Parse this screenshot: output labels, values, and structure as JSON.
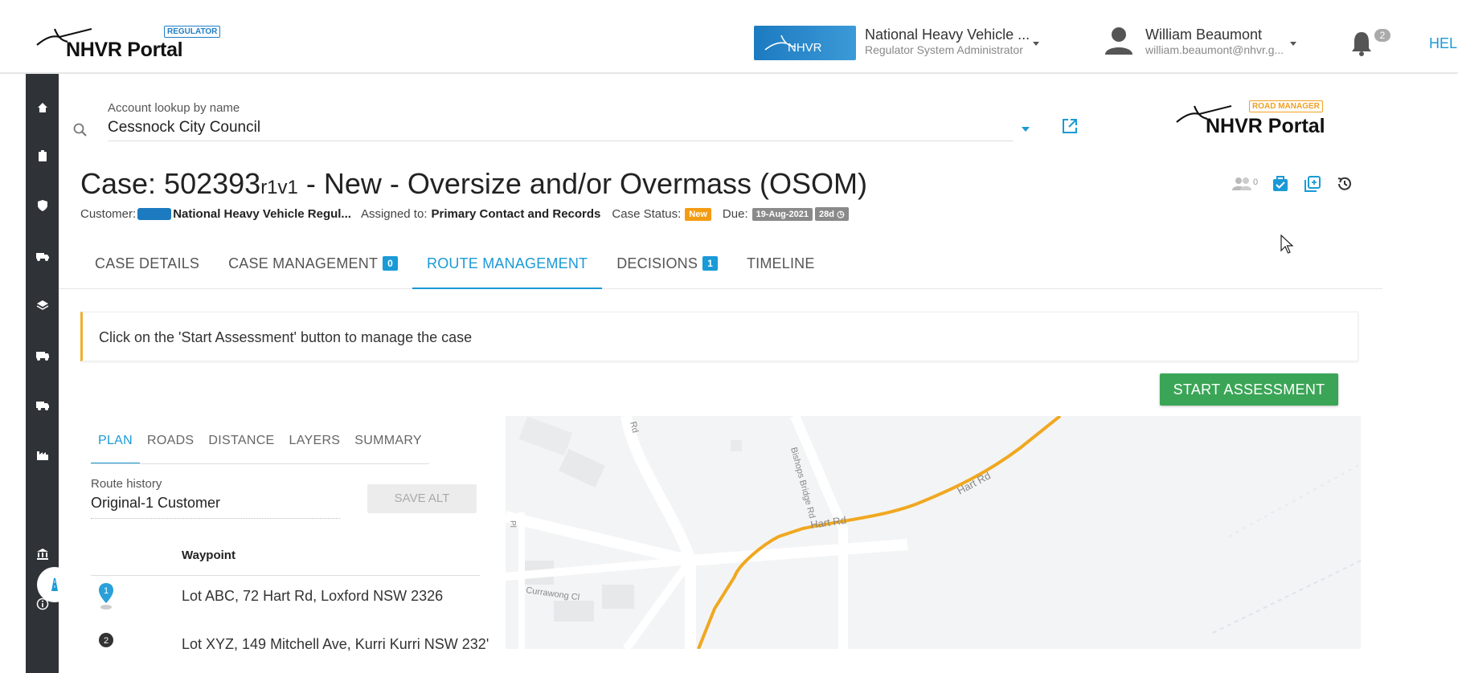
{
  "header": {
    "logo_text": "NHVR Portal",
    "logo_badge": "REGULATOR",
    "org_logo_text": "NHVR",
    "org_name": "National Heavy Vehicle ...",
    "org_role": "Regulator System Administrator",
    "user_name": "William Beaumont",
    "user_email": "william.beaumont@nhvr.g...",
    "notification_count": "2",
    "help_label": "HEL"
  },
  "account_lookup": {
    "label": "Account lookup by name",
    "value": "Cessnock City Council"
  },
  "road_manager_logo": {
    "text": "NHVR Portal",
    "badge": "ROAD MANAGER"
  },
  "case": {
    "title_prefix": "Case: 502393",
    "revision": "r1v1",
    "title_suffix": " - New - Oversize and/or Overmass (OSOM)",
    "customer_label": "Customer:",
    "customer_name": "National Heavy Vehicle Regul...",
    "assigned_label": "Assigned to:",
    "assigned_value": "Primary Contact and Records",
    "status_label": "Case Status:",
    "status_value": "New",
    "due_label": "Due:",
    "due_date": "19-Aug-2021",
    "due_days": "28d",
    "watchers_count": "0"
  },
  "tabs": [
    {
      "label": "CASE DETAILS",
      "count": ""
    },
    {
      "label": "CASE MANAGEMENT",
      "count": "0"
    },
    {
      "label": "ROUTE MANAGEMENT",
      "count": ""
    },
    {
      "label": "DECISIONS",
      "count": "1"
    },
    {
      "label": "TIMELINE",
      "count": ""
    }
  ],
  "notice_text": "Click on the 'Start Assessment' button to manage the case",
  "start_button": "START ASSESSMENT",
  "route": {
    "sub_tabs": [
      "PLAN",
      "ROADS",
      "DISTANCE",
      "LAYERS",
      "SUMMARY"
    ],
    "history_label": "Route history",
    "history_value": "Original-1 Customer",
    "save_alt": "SAVE ALT",
    "waypoint_header": "Waypoint",
    "waypoints": [
      {
        "num": "1",
        "address": "Lot ABC, 72 Hart Rd, Loxford NSW 2326"
      },
      {
        "num": "2",
        "address": "Lot XYZ, 149 Mitchell Ave, Kurri Kurri NSW 232'"
      }
    ]
  },
  "map": {
    "labels": [
      "Hart Rd",
      "Hart Rd",
      "Bishops Bridge Rd",
      "Currawong Cl",
      "Rd",
      "Pl"
    ],
    "route_color": "#f0a820"
  },
  "colors": {
    "accent": "#1a9ad6",
    "start": "#3aa556",
    "warning": "#f39c12",
    "sidebar": "#2f3338"
  }
}
